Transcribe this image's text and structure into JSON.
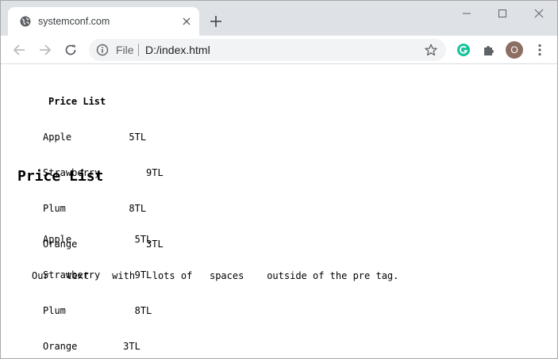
{
  "browser": {
    "tab": {
      "title": "systemconf.com"
    },
    "address": {
      "scheme": "File",
      "url": "D:/index.html"
    },
    "profile_initial": "O",
    "accent_colors": {
      "grammarly": "#15c39a",
      "avatar": "#8d6e63"
    }
  },
  "content": {
    "pre1": {
      "title": "Price List",
      "lines": [
        "Apple          5TL",
        "Strawberry        9TL",
        "Plum           8TL",
        "Orange            3TL"
      ]
    },
    "heading": "Price List",
    "pre2": {
      "lines": [
        "Apple           5TL",
        "Strawberry      9TL",
        "Plum            8TL",
        "Orange        3TL"
      ]
    },
    "paragraph": "Our   text    with   lots of   spaces    outside of the pre tag."
  }
}
